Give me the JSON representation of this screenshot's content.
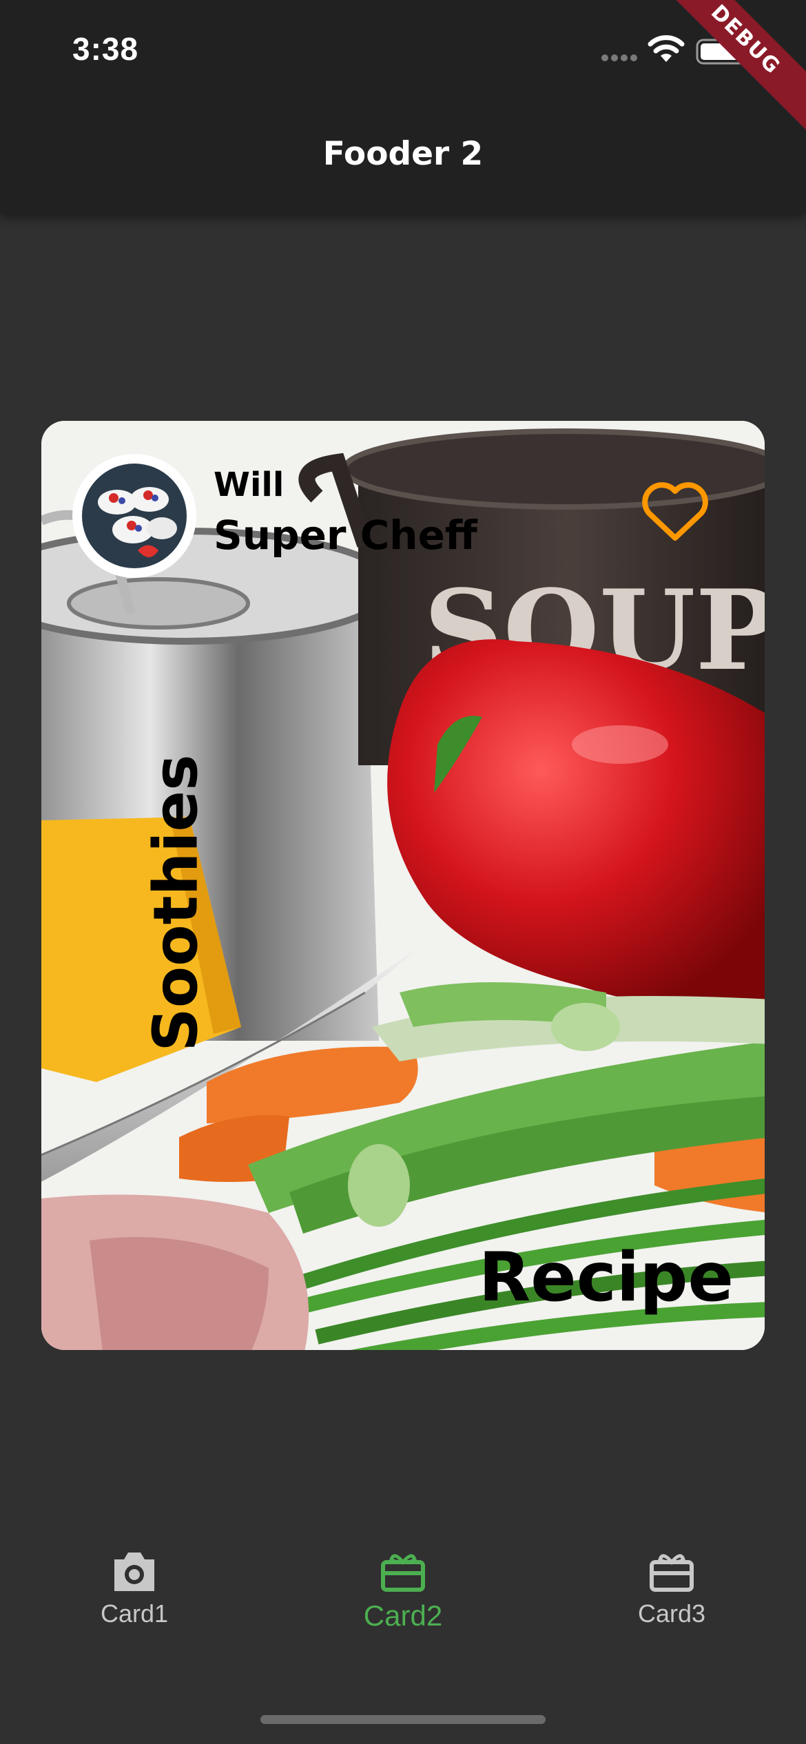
{
  "status_bar": {
    "time": "3:38"
  },
  "debug_banner": "DEBUG",
  "app_bar": {
    "title": "Fooder 2"
  },
  "card": {
    "author_name": "Will",
    "author_title": "Super Cheff",
    "category": "Soothies",
    "label": "Recipe",
    "favorite_icon": "heart-outline-icon",
    "accent_color": "#ff9800"
  },
  "bottom_nav": {
    "selected_index": 1,
    "selected_color": "#4caf50",
    "items": [
      {
        "label": "Card1",
        "icon": "camera-icon"
      },
      {
        "label": "Card2",
        "icon": "card-giftcard-icon"
      },
      {
        "label": "Card3",
        "icon": "card-giftcard-icon"
      }
    ]
  }
}
